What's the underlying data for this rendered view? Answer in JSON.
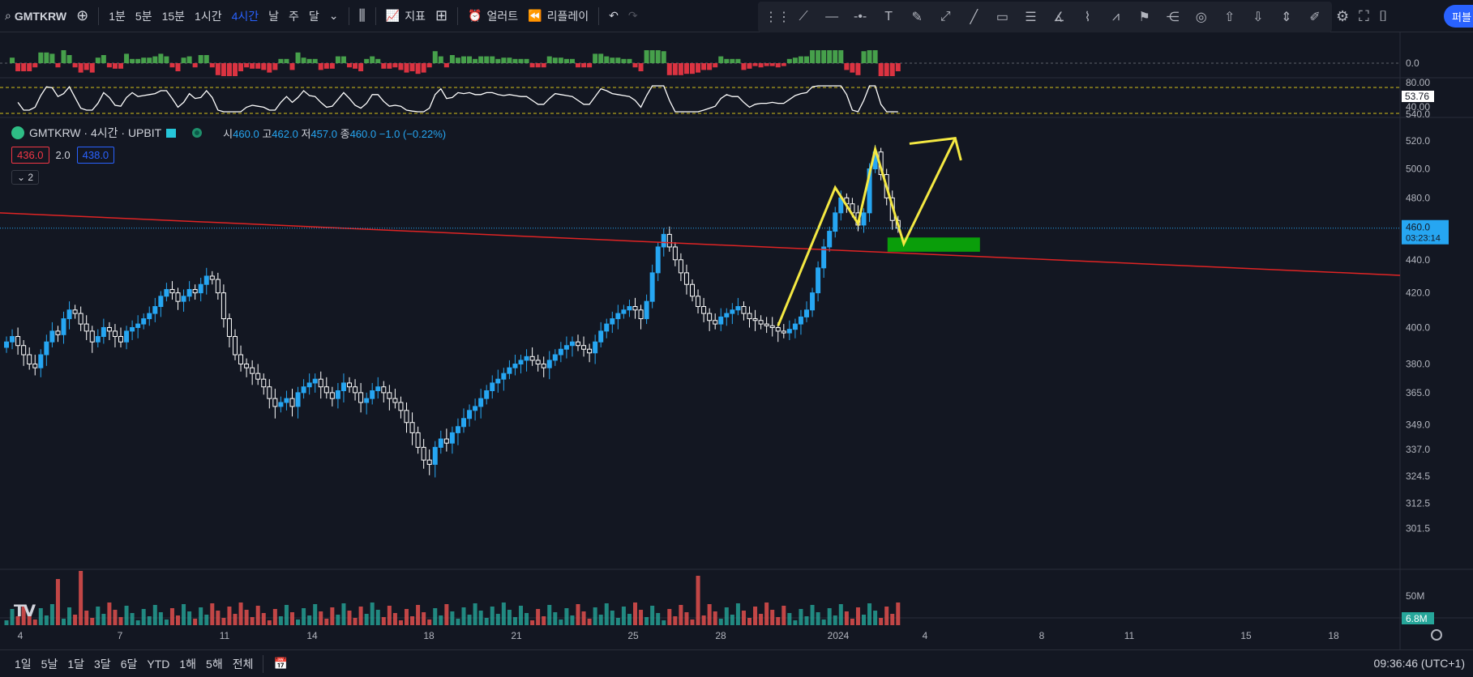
{
  "toolbar": {
    "symbol": "GMTKRW",
    "intervals": [
      "1분",
      "5분",
      "15분",
      "1시간",
      "4시간",
      "날",
      "주",
      "달"
    ],
    "active_interval": "4시간",
    "indicators_label": "지표",
    "alert_label": "얼러트",
    "replay_label": "리플레이",
    "cta_label": "퍼블"
  },
  "legend": {
    "title": "GMTKRW · 4시간 · UPBIT",
    "open_label": "시",
    "open": "460.0",
    "high_label": "고",
    "high": "462.0",
    "low_label": "저",
    "low": "457.0",
    "close_label": "종",
    "close": "460.0",
    "change": "−1.0 (−0.22%)",
    "bid": "436.0",
    "spread": "2.0",
    "ask": "438.0",
    "collapsed_count": "2"
  },
  "colors": {
    "background": "#131722",
    "up": "#26a6f2",
    "down": "#ffffff",
    "trendline": "#e02424",
    "zone": "#0a9e0a",
    "drawing": "#f4e842",
    "vol_up": "#26a69a",
    "vol_down": "#ef5350"
  },
  "price_axis": [
    "540.0",
    "520.0",
    "500.0",
    "480.0",
    "460.0",
    "440.0",
    "420.0",
    "400.0",
    "380.0",
    "365.0",
    "349.0",
    "337.0",
    "324.5",
    "312.5",
    "301.5"
  ],
  "last_price": {
    "price": "460.0",
    "countdown": "03:23:14"
  },
  "osc1_axis": [
    "0.0"
  ],
  "osc2_axis": [
    "80.00",
    "53.76",
    "40.00"
  ],
  "osc2_value": "53.76",
  "volume_axis": [
    "50M"
  ],
  "volume_value": "6.8M",
  "time_axis": [
    "4",
    "7",
    "11",
    "14",
    "18",
    "21",
    "25",
    "28",
    "2024",
    "4",
    "8",
    "11",
    "15",
    "18"
  ],
  "bottom": {
    "ranges": [
      "1일",
      "5날",
      "1달",
      "3달",
      "6달",
      "YTD",
      "1해",
      "5해",
      "전체"
    ],
    "clock": "09:36:46 (UTC+1)"
  },
  "chart_data": {
    "type": "candlestick",
    "title": "GMTKRW · 4시간 · UPBIT",
    "x_start_label": "4",
    "y_log": true,
    "ylim": [
      298,
      548
    ],
    "close_series": [
      392,
      395,
      390,
      385,
      380,
      378,
      385,
      392,
      398,
      396,
      405,
      410,
      408,
      402,
      398,
      392,
      395,
      400,
      398,
      395,
      392,
      398,
      400,
      402,
      405,
      408,
      412,
      418,
      422,
      420,
      415,
      418,
      422,
      420,
      425,
      430,
      428,
      420,
      405,
      395,
      385,
      380,
      378,
      375,
      372,
      368,
      362,
      358,
      360,
      362,
      358,
      365,
      368,
      370,
      372,
      368,
      365,
      362,
      366,
      370,
      368,
      365,
      360,
      362,
      366,
      368,
      365,
      362,
      360,
      356,
      350,
      345,
      338,
      332,
      330,
      338,
      342,
      340,
      345,
      348,
      352,
      356,
      358,
      362,
      366,
      370,
      372,
      375,
      378,
      380,
      382,
      384,
      382,
      380,
      378,
      382,
      385,
      388,
      390,
      392,
      390,
      388,
      386,
      392,
      398,
      402,
      405,
      408,
      410,
      412,
      410,
      405,
      415,
      432,
      448,
      456,
      448,
      440,
      432,
      425,
      418,
      412,
      408,
      404,
      402,
      406,
      408,
      410,
      412,
      408,
      405,
      404,
      402,
      401,
      400,
      398,
      397,
      399,
      402,
      406,
      410,
      420,
      435,
      448,
      458,
      470,
      480,
      476,
      470,
      462,
      470,
      500,
      512,
      496,
      480,
      465,
      460
    ],
    "annotations": [
      "descending trendline",
      "green support zone",
      "yellow zigzag projection"
    ]
  }
}
